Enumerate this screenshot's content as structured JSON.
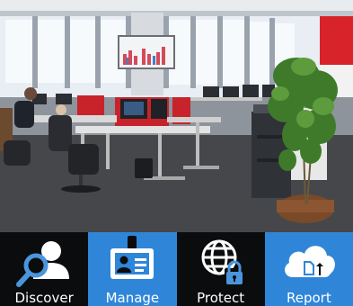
{
  "colors": {
    "tile_dark": "#0b0c0e",
    "tile_blue": "#2f86d8",
    "icon_blue": "#4a95dc",
    "label_text": "#ffffff"
  },
  "hero": {
    "image": "office-photo"
  },
  "tiles": [
    {
      "label": "Discover",
      "icon": "magnifier-person-icon",
      "style": "dark"
    },
    {
      "label": "Manage",
      "icon": "id-badge-icon",
      "style": "blue"
    },
    {
      "label": "Protect",
      "icon": "globe-lock-icon",
      "style": "dark"
    },
    {
      "label": "Report",
      "icon": "cloud-document-upload-icon",
      "style": "blue"
    }
  ]
}
